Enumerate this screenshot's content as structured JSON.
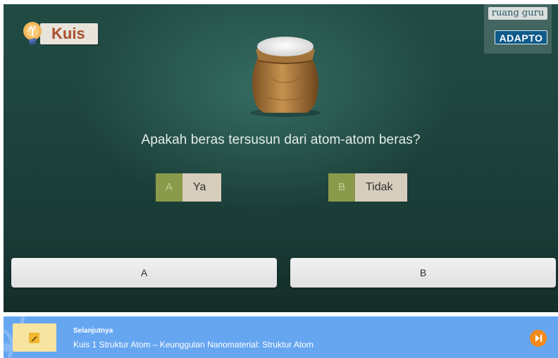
{
  "quiz": {
    "badge_label": "Kuis",
    "question": "Apakah beras tersusun dari atom-atom beras?",
    "choices": [
      {
        "letter": "A",
        "text": "Ya"
      },
      {
        "letter": "B",
        "text": "Tidak"
      }
    ],
    "answer_buttons": [
      "A",
      "B"
    ]
  },
  "brand": {
    "name": "ruang guru",
    "product": "ADAPTO"
  },
  "next": {
    "kicker": "Selanjutnya",
    "title": "Kuis 1 Struktur Atom – Keunggulan Nanomaterial: Struktur Atom"
  },
  "icons": {
    "badge": "lightbulb-icon",
    "illustration": "rice-sack-icon",
    "thumb": "note-icon",
    "next": "play-next-icon"
  },
  "colors": {
    "stage": "#1f4640",
    "choice_letter": "#8a9a4a",
    "choice_text": "#d7cdbd",
    "kuis_text": "#ab4f2d",
    "next_bar": "#66a6f1",
    "next_button": "#f38a1c"
  }
}
